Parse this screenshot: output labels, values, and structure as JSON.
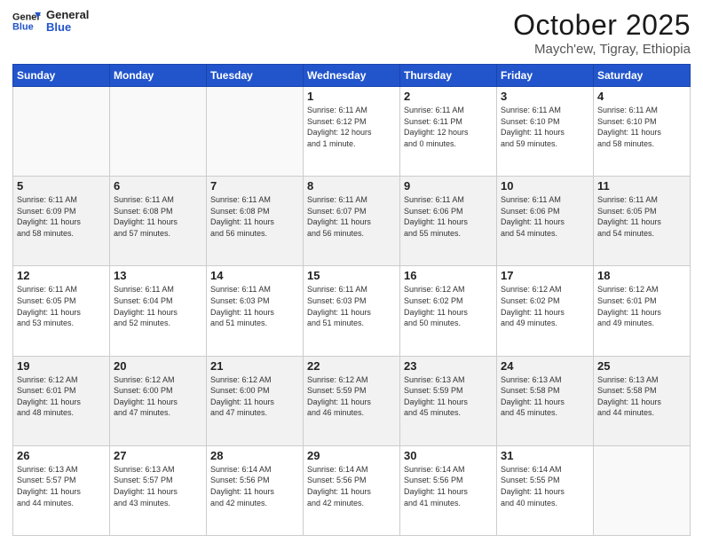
{
  "header": {
    "logo_line1": "General",
    "logo_line2": "Blue",
    "month": "October 2025",
    "location": "Maych'ew, Tigray, Ethiopia"
  },
  "weekdays": [
    "Sunday",
    "Monday",
    "Tuesday",
    "Wednesday",
    "Thursday",
    "Friday",
    "Saturday"
  ],
  "weeks": [
    [
      {
        "day": "",
        "text": ""
      },
      {
        "day": "",
        "text": ""
      },
      {
        "day": "",
        "text": ""
      },
      {
        "day": "1",
        "text": "Sunrise: 6:11 AM\nSunset: 6:12 PM\nDaylight: 12 hours\nand 1 minute."
      },
      {
        "day": "2",
        "text": "Sunrise: 6:11 AM\nSunset: 6:11 PM\nDaylight: 12 hours\nand 0 minutes."
      },
      {
        "day": "3",
        "text": "Sunrise: 6:11 AM\nSunset: 6:10 PM\nDaylight: 11 hours\nand 59 minutes."
      },
      {
        "day": "4",
        "text": "Sunrise: 6:11 AM\nSunset: 6:10 PM\nDaylight: 11 hours\nand 58 minutes."
      }
    ],
    [
      {
        "day": "5",
        "text": "Sunrise: 6:11 AM\nSunset: 6:09 PM\nDaylight: 11 hours\nand 58 minutes."
      },
      {
        "day": "6",
        "text": "Sunrise: 6:11 AM\nSunset: 6:08 PM\nDaylight: 11 hours\nand 57 minutes."
      },
      {
        "day": "7",
        "text": "Sunrise: 6:11 AM\nSunset: 6:08 PM\nDaylight: 11 hours\nand 56 minutes."
      },
      {
        "day": "8",
        "text": "Sunrise: 6:11 AM\nSunset: 6:07 PM\nDaylight: 11 hours\nand 56 minutes."
      },
      {
        "day": "9",
        "text": "Sunrise: 6:11 AM\nSunset: 6:06 PM\nDaylight: 11 hours\nand 55 minutes."
      },
      {
        "day": "10",
        "text": "Sunrise: 6:11 AM\nSunset: 6:06 PM\nDaylight: 11 hours\nand 54 minutes."
      },
      {
        "day": "11",
        "text": "Sunrise: 6:11 AM\nSunset: 6:05 PM\nDaylight: 11 hours\nand 54 minutes."
      }
    ],
    [
      {
        "day": "12",
        "text": "Sunrise: 6:11 AM\nSunset: 6:05 PM\nDaylight: 11 hours\nand 53 minutes."
      },
      {
        "day": "13",
        "text": "Sunrise: 6:11 AM\nSunset: 6:04 PM\nDaylight: 11 hours\nand 52 minutes."
      },
      {
        "day": "14",
        "text": "Sunrise: 6:11 AM\nSunset: 6:03 PM\nDaylight: 11 hours\nand 51 minutes."
      },
      {
        "day": "15",
        "text": "Sunrise: 6:11 AM\nSunset: 6:03 PM\nDaylight: 11 hours\nand 51 minutes."
      },
      {
        "day": "16",
        "text": "Sunrise: 6:12 AM\nSunset: 6:02 PM\nDaylight: 11 hours\nand 50 minutes."
      },
      {
        "day": "17",
        "text": "Sunrise: 6:12 AM\nSunset: 6:02 PM\nDaylight: 11 hours\nand 49 minutes."
      },
      {
        "day": "18",
        "text": "Sunrise: 6:12 AM\nSunset: 6:01 PM\nDaylight: 11 hours\nand 49 minutes."
      }
    ],
    [
      {
        "day": "19",
        "text": "Sunrise: 6:12 AM\nSunset: 6:01 PM\nDaylight: 11 hours\nand 48 minutes."
      },
      {
        "day": "20",
        "text": "Sunrise: 6:12 AM\nSunset: 6:00 PM\nDaylight: 11 hours\nand 47 minutes."
      },
      {
        "day": "21",
        "text": "Sunrise: 6:12 AM\nSunset: 6:00 PM\nDaylight: 11 hours\nand 47 minutes."
      },
      {
        "day": "22",
        "text": "Sunrise: 6:12 AM\nSunset: 5:59 PM\nDaylight: 11 hours\nand 46 minutes."
      },
      {
        "day": "23",
        "text": "Sunrise: 6:13 AM\nSunset: 5:59 PM\nDaylight: 11 hours\nand 45 minutes."
      },
      {
        "day": "24",
        "text": "Sunrise: 6:13 AM\nSunset: 5:58 PM\nDaylight: 11 hours\nand 45 minutes."
      },
      {
        "day": "25",
        "text": "Sunrise: 6:13 AM\nSunset: 5:58 PM\nDaylight: 11 hours\nand 44 minutes."
      }
    ],
    [
      {
        "day": "26",
        "text": "Sunrise: 6:13 AM\nSunset: 5:57 PM\nDaylight: 11 hours\nand 44 minutes."
      },
      {
        "day": "27",
        "text": "Sunrise: 6:13 AM\nSunset: 5:57 PM\nDaylight: 11 hours\nand 43 minutes."
      },
      {
        "day": "28",
        "text": "Sunrise: 6:14 AM\nSunset: 5:56 PM\nDaylight: 11 hours\nand 42 minutes."
      },
      {
        "day": "29",
        "text": "Sunrise: 6:14 AM\nSunset: 5:56 PM\nDaylight: 11 hours\nand 42 minutes."
      },
      {
        "day": "30",
        "text": "Sunrise: 6:14 AM\nSunset: 5:56 PM\nDaylight: 11 hours\nand 41 minutes."
      },
      {
        "day": "31",
        "text": "Sunrise: 6:14 AM\nSunset: 5:55 PM\nDaylight: 11 hours\nand 40 minutes."
      },
      {
        "day": "",
        "text": ""
      }
    ]
  ]
}
